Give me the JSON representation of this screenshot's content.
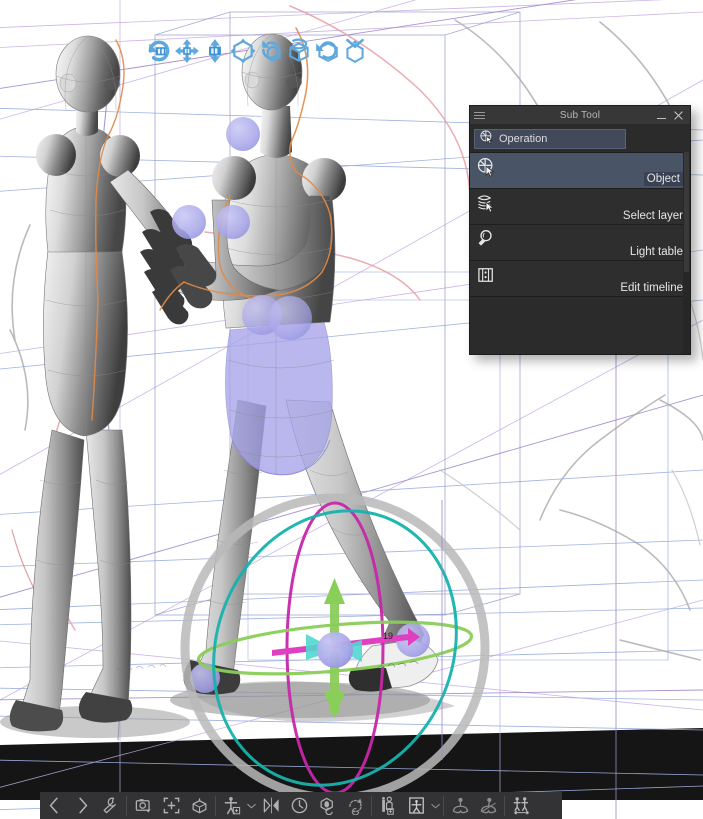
{
  "app": {
    "canvas_background": "#ffffff",
    "ground_color": "#151515"
  },
  "operation_bar": {
    "name": "3d-object-manipulation-bar",
    "buttons": [
      {
        "name": "rotate-object-left-icon",
        "title": "Rotate left"
      },
      {
        "name": "move-plane-icon",
        "title": "Move in plane"
      },
      {
        "name": "move-depth-icon",
        "title": "Move in depth"
      },
      {
        "name": "move-3d-axes-icon",
        "title": "Move along axes"
      },
      {
        "name": "rotate-box-vertical-icon",
        "title": "Rotate vertically"
      },
      {
        "name": "rotate-box-horizontal-icon",
        "title": "Rotate horizontally"
      },
      {
        "name": "rotate-box-plane-icon",
        "title": "Rotate in plane"
      },
      {
        "name": "reset-object-icon",
        "title": "Reset object"
      }
    ]
  },
  "subtool": {
    "title": "Sub Tool",
    "menu_icon": "hamburger-icon",
    "minimize_label": "minimize-icon",
    "close_label": "close-icon",
    "combo": {
      "label": "Operation",
      "icon": "operation-cube-cursor-icon"
    },
    "items": [
      {
        "label": "Object",
        "icon": "object-cube-cursor-icon",
        "selected": true
      },
      {
        "label": "Select layer",
        "icon": "select-layer-stack-cursor-icon",
        "selected": false
      },
      {
        "label": "Light table",
        "icon": "light-table-bulb-icon",
        "selected": false
      },
      {
        "label": "Edit timeline",
        "icon": "edit-timeline-frames-icon",
        "selected": false
      }
    ],
    "selected_bg": "#4a5467",
    "panel_bg": "#2b2b2b"
  },
  "bottom_toolbar": {
    "name": "3d-figure-toolbar",
    "groups": [
      {
        "buttons": [
          {
            "name": "previous-pose-icon",
            "title": "Previous",
            "type": "icon"
          },
          {
            "name": "next-pose-icon",
            "title": "Next",
            "type": "icon"
          },
          {
            "name": "tool-wrench-icon",
            "title": "Tool settings",
            "type": "icon"
          }
        ]
      },
      {
        "buttons": [
          {
            "name": "camera-register-icon",
            "title": "Register camera",
            "type": "icon"
          },
          {
            "name": "fit-to-frame-icon",
            "title": "Fit to frame",
            "type": "icon"
          },
          {
            "name": "register-object-icon",
            "title": "Register object",
            "type": "icon"
          }
        ]
      },
      {
        "buttons": [
          {
            "name": "add-figure-icon",
            "title": "Add figure",
            "type": "icon"
          },
          {
            "name": "add-figure-dropdown-icon",
            "title": "More figures",
            "type": "caret"
          },
          {
            "name": "flip-pose-icon",
            "title": "Flip pose",
            "type": "icon"
          },
          {
            "name": "reset-pose-icon",
            "title": "Reset pose",
            "type": "icon"
          },
          {
            "name": "register-pose-icon",
            "title": "Register pose",
            "type": "icon"
          },
          {
            "name": "reset-rotation-icon",
            "title": "Reset rotation",
            "type": "icon"
          }
        ]
      },
      {
        "buttons": [
          {
            "name": "add-hand-pose-icon",
            "title": "Hand pose",
            "type": "icon"
          },
          {
            "name": "body-proportions-icon",
            "title": "Body shape",
            "type": "icon"
          },
          {
            "name": "body-proportions-dropdown-icon",
            "title": "More body settings",
            "type": "caret"
          }
        ]
      },
      {
        "buttons": [
          {
            "name": "fix-joint-icon",
            "title": "Fix joint",
            "type": "icon"
          },
          {
            "name": "release-joint-icon",
            "title": "Release joint",
            "type": "icon"
          }
        ]
      },
      {
        "buttons": [
          {
            "name": "figure-spacing-icon",
            "title": "Figure spacing",
            "type": "icon"
          }
        ]
      }
    ]
  },
  "canvas": {
    "gizmo": {
      "name": "3d-manipulation-gizmo",
      "angle_label": "19",
      "ring_colors": {
        "x_ring": "#c627a8",
        "y_ring": "#8ace5a",
        "z_ring": "#16b2ac",
        "outer_ring": "#b8b8b8"
      },
      "axis_colors": {
        "x_axis": "#e040c0",
        "y_axis": "#8ace5a",
        "z_axis": "#4fd8d0"
      },
      "center_handle_color": "#a6a4e8"
    },
    "figures": {
      "joint_handle_color": "#a6a4e8",
      "selection_highlight_color": "#a6a4e8",
      "outline_sketch_color": "#e08a4a",
      "perspective_guide_color": "#b49ad8",
      "horizon_guide_color": "#9aaede"
    }
  }
}
